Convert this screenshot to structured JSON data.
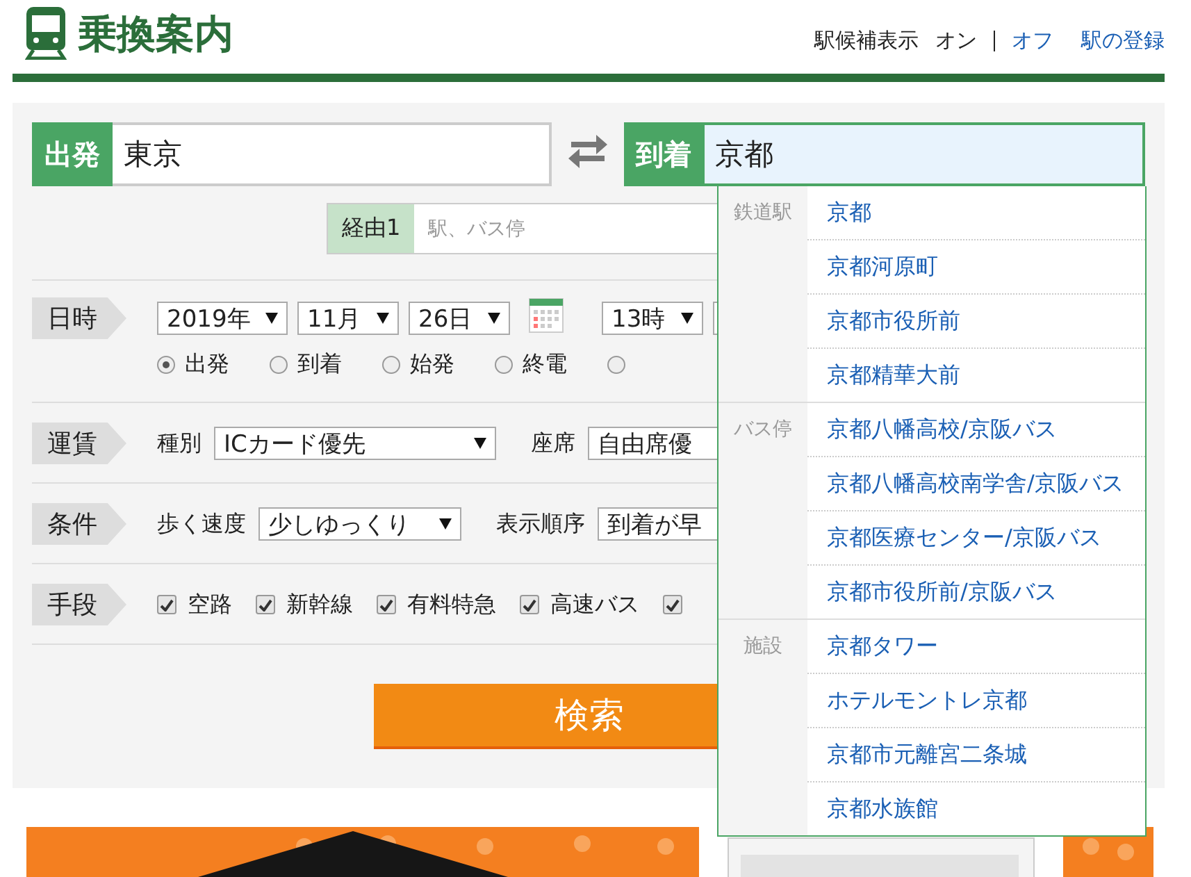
{
  "header": {
    "title": "乗換案内",
    "hint_label": "駅候補表示",
    "hint_options": [
      {
        "label": "オン",
        "selected": true
      },
      {
        "label": "オフ",
        "selected": false
      }
    ],
    "register_link": "駅の登録"
  },
  "route": {
    "from": {
      "label": "出発",
      "value": "東京"
    },
    "to": {
      "label": "到着",
      "value": "京都"
    },
    "via": {
      "label": "経由1",
      "placeholder": "駅、バス停"
    }
  },
  "datetime": {
    "label": "日時",
    "selects": [
      "2019年",
      "11月",
      "26日"
    ],
    "hour": "13時",
    "modes": [
      {
        "label": "出発",
        "selected": true
      },
      {
        "label": "到着",
        "selected": false
      },
      {
        "label": "始発",
        "selected": false
      },
      {
        "label": "終電",
        "selected": false
      },
      {
        "selected": false
      }
    ]
  },
  "fare": {
    "label": "運賃",
    "fields": [
      {
        "label": "種別",
        "value": "ICカード優先"
      },
      {
        "label": "座席",
        "value": "自由席優"
      }
    ]
  },
  "conditions": {
    "label": "条件",
    "fields": [
      {
        "label": "歩く速度",
        "value": "少しゆっくり"
      },
      {
        "label": "表示順序",
        "value": "到着が早"
      }
    ]
  },
  "means": {
    "label": "手段",
    "options": [
      {
        "label": "空路",
        "checked": true
      },
      {
        "label": "新幹線",
        "checked": true
      },
      {
        "label": "有料特急",
        "checked": true
      },
      {
        "label": "高速バス",
        "checked": true
      },
      {
        "checked": true
      }
    ]
  },
  "search_button": "検索",
  "suggestions": [
    {
      "category": "鉄道駅",
      "items": [
        "京都",
        "京都河原町",
        "京都市役所前",
        "京都精華大前"
      ]
    },
    {
      "category": "バス停",
      "items": [
        "京都八幡高校/京阪バス",
        "京都八幡高校南学舎/京阪バス",
        "京都医療センター/京阪バス",
        "京都市役所前/京阪バス"
      ]
    },
    {
      "category": "施設",
      "items": [
        "京都タワー",
        "ホテルモントレ京都",
        "京都市元離宮二条城",
        "京都水族館"
      ]
    }
  ]
}
